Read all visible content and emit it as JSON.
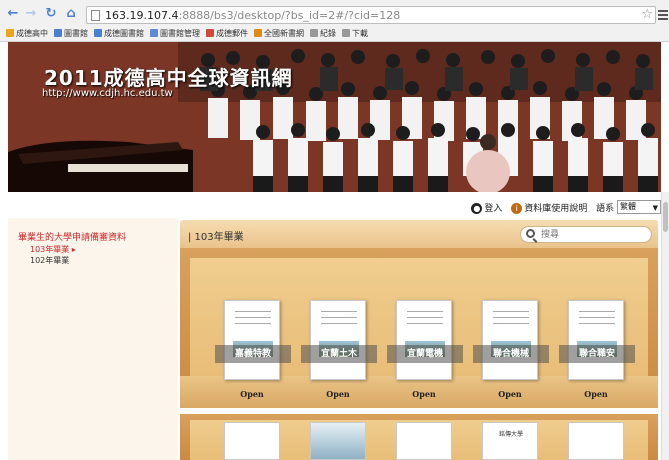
{
  "browser": {
    "url_host": "163.19.107.4",
    "url_rest": ":8888/bs3/desktop/?bs_id=2#/?cid=128",
    "bookmarks": [
      {
        "label": "成德高中",
        "color": "#e9a51b"
      },
      {
        "label": "圖書館",
        "color": "#4a7fd1"
      },
      {
        "label": "成德圖書館",
        "color": "#4a7fd1"
      },
      {
        "label": "圖書館管理",
        "color": "#5a8ad8"
      },
      {
        "label": "成德郵件",
        "color": "#d04a3a"
      },
      {
        "label": "全國新書網",
        "color": "#e08a1a"
      },
      {
        "label": "紀錄",
        "color": "#999999"
      },
      {
        "label": "下載",
        "color": "#999999"
      }
    ]
  },
  "banner": {
    "title": "2011成德高中全球資訊網",
    "url": "http://www.cdjh.hc.edu.tw"
  },
  "topbar": {
    "login": "登入",
    "help": "資料庫使用說明",
    "lang_label": "語系",
    "lang_value": "繁體"
  },
  "sidebar": {
    "title": "畢業生的大學申請備審資料",
    "items": [
      {
        "label": "103年畢業 ▸",
        "active": true
      },
      {
        "label": "102年畢業",
        "active": false
      }
    ]
  },
  "shelf": {
    "label": "| 103年畢業",
    "search_placeholder": "搜尋",
    "books": [
      {
        "title": "嘉義特教",
        "open": "Open"
      },
      {
        "title": "宜蘭土木",
        "open": "Open"
      },
      {
        "title": "宜蘭電機",
        "open": "Open"
      },
      {
        "title": "聯合機械",
        "open": "Open"
      },
      {
        "title": "聯合職安",
        "open": "Open"
      }
    ],
    "row2_books": [
      {
        "title": ""
      },
      {
        "title": ""
      },
      {
        "title": ""
      },
      {
        "title": "銘傳大學"
      },
      {
        "title": ""
      }
    ]
  }
}
